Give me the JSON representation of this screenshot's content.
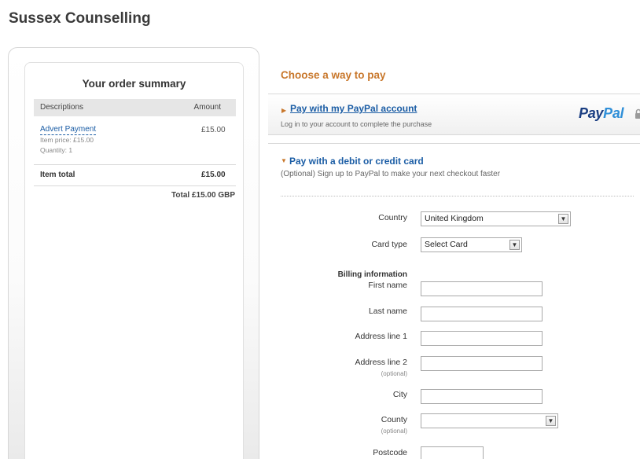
{
  "merchant": {
    "name": "Sussex Counselling"
  },
  "order_summary": {
    "title": "Your order summary",
    "columns": {
      "description": "Descriptions",
      "amount": "Amount"
    },
    "item": {
      "name": "Advert Payment",
      "amount": "£15.00",
      "price": "Item price: £15.00",
      "quantity": "Quantity: 1"
    },
    "item_total_label": "Item total",
    "item_total_amount": "£15.00",
    "grand_total": "Total £15.00 GBP"
  },
  "payment": {
    "title": "Choose a way to pay",
    "paypal_option": {
      "link": "Pay with my PayPal account",
      "subtitle": "Log in to your account to complete the purchase",
      "logo_pay": "Pay",
      "logo_pal": "Pal"
    },
    "card_option": {
      "title": "Pay with a debit or credit card",
      "subtitle": "(Optional) Sign up to PayPal to make your next checkout faster"
    }
  },
  "form": {
    "country": {
      "label": "Country",
      "value": "United Kingdom"
    },
    "card_type": {
      "label": "Card type",
      "value": "Select Card"
    },
    "billing_heading": "Billing information",
    "first_name": {
      "label": "First name",
      "value": ""
    },
    "last_name": {
      "label": "Last name",
      "value": ""
    },
    "address1": {
      "label": "Address line 1",
      "value": ""
    },
    "address2": {
      "label": "Address line 2",
      "note": "(optional)",
      "value": ""
    },
    "city": {
      "label": "City",
      "value": ""
    },
    "county": {
      "label": "County",
      "note": "(optional)",
      "value": ""
    },
    "postcode": {
      "label": "Postcode",
      "value": ""
    }
  },
  "colors": {
    "accent_orange": "#c8772b",
    "link_blue": "#1b5da5",
    "paypal_dark": "#1a3e82",
    "paypal_light": "#2f8fd8"
  },
  "icons": {
    "expand": "arrow-right-icon",
    "collapse": "arrow-down-icon",
    "secure": "lock-icon",
    "dropdown": "chevron-down-icon"
  }
}
